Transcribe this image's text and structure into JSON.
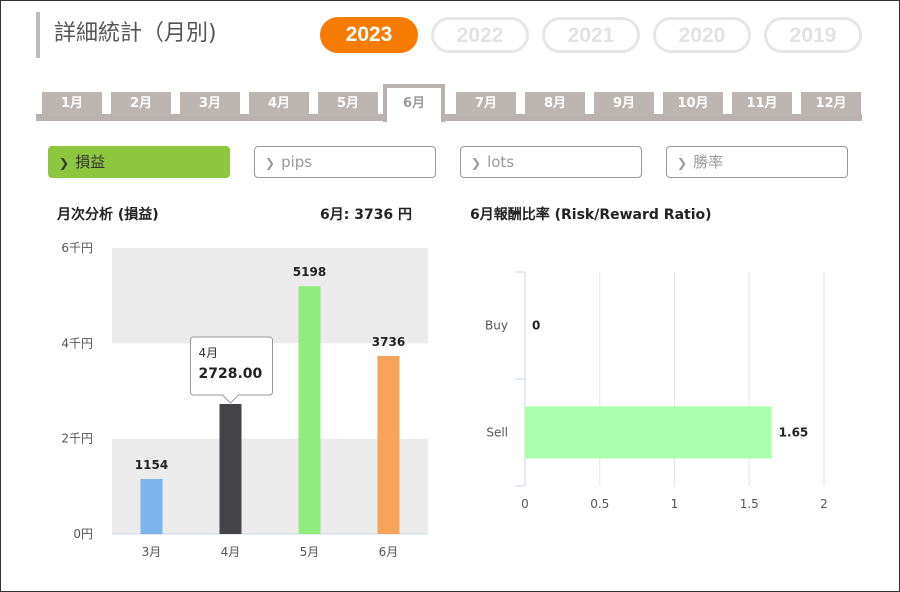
{
  "header": {
    "title": "詳細統計（月別)"
  },
  "years": [
    {
      "label": "2023",
      "active": true
    },
    {
      "label": "2022",
      "active": false
    },
    {
      "label": "2021",
      "active": false
    },
    {
      "label": "2020",
      "active": false
    },
    {
      "label": "2019",
      "active": false
    }
  ],
  "months": [
    "1月",
    "2月",
    "3月",
    "4月",
    "5月",
    "6月",
    "7月",
    "8月",
    "9月",
    "10月",
    "11月",
    "12月"
  ],
  "active_month": "6月",
  "metrics": [
    {
      "label": "損益",
      "active": true
    },
    {
      "label": "pips",
      "active": false
    },
    {
      "label": "lots",
      "active": false
    },
    {
      "label": "勝率",
      "active": false
    }
  ],
  "left_panel": {
    "title": "月次分析 (損益)",
    "summary": "6月:  3736 円"
  },
  "right_panel": {
    "title": "6月報酬比率 (Risk/Reward Ratio)"
  },
  "tooltip": {
    "month": "4月",
    "value": "2728.00"
  },
  "colors": {
    "accent": "#f57c00",
    "active_metric": "#8dc63f"
  },
  "chart_data": [
    {
      "type": "bar",
      "categories": [
        "3月",
        "4月",
        "5月",
        "6月"
      ],
      "values": [
        1154,
        2728,
        5198,
        3736
      ],
      "colors": [
        "#7db5ea",
        "#434348",
        "#90ed7d",
        "#f7a35c"
      ],
      "yticks": [
        "0円",
        "2千円",
        "4千円",
        "6千円"
      ],
      "ylim": [
        0,
        6000
      ]
    },
    {
      "type": "bar",
      "orientation": "horizontal",
      "categories": [
        "Buy",
        "Sell"
      ],
      "values": [
        0,
        1.65
      ],
      "value_labels": [
        "0",
        "1.65"
      ],
      "xticks": [
        "0",
        "0.5",
        "1",
        "1.5",
        "2"
      ],
      "xlim": [
        0,
        2
      ],
      "color": "#aaffaa"
    }
  ]
}
